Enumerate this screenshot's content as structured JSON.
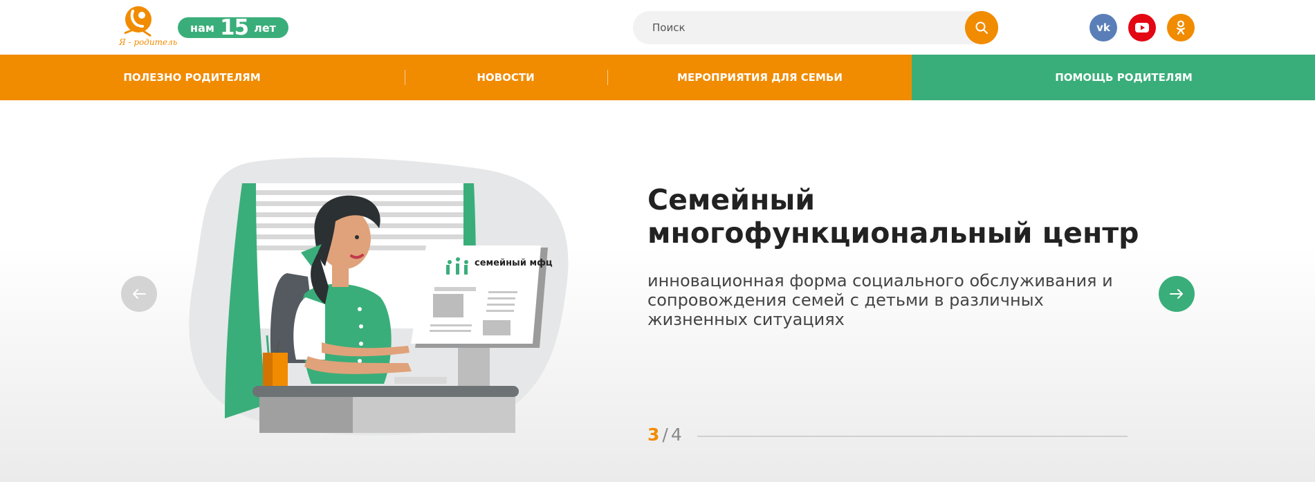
{
  "header": {
    "logo_text": "Я - родитель",
    "badge": {
      "prefix": "нам",
      "number": "15",
      "suffix": "лет"
    },
    "search": {
      "placeholder": "Поиск"
    },
    "social": [
      {
        "name": "vk",
        "glyph": "vk"
      },
      {
        "name": "youtube"
      },
      {
        "name": "odnoklassniki"
      }
    ]
  },
  "nav": {
    "items": [
      {
        "label": "ПОЛЕЗНО РОДИТЕЛЯМ"
      },
      {
        "label": "НОВОСТИ"
      },
      {
        "label": "МЕРОПРИЯТИЯ ДЛЯ СЕМЬИ"
      },
      {
        "label": "ПОМОЩЬ РОДИТЕЛЯМ"
      }
    ]
  },
  "slide": {
    "title": "Семейный многофункциональный центр",
    "description": "инновационная форма социального обслуживания и сопровождения семей с детьми в различных жизненных ситуациях",
    "illustration": {
      "screen_brand": "семейный мфц"
    },
    "pager": {
      "current": "3",
      "separator": "/",
      "total": "4"
    }
  },
  "colors": {
    "orange": "#f18b00",
    "green": "#3aae7a",
    "vk": "#5a7fb8",
    "youtube": "#e30613"
  }
}
